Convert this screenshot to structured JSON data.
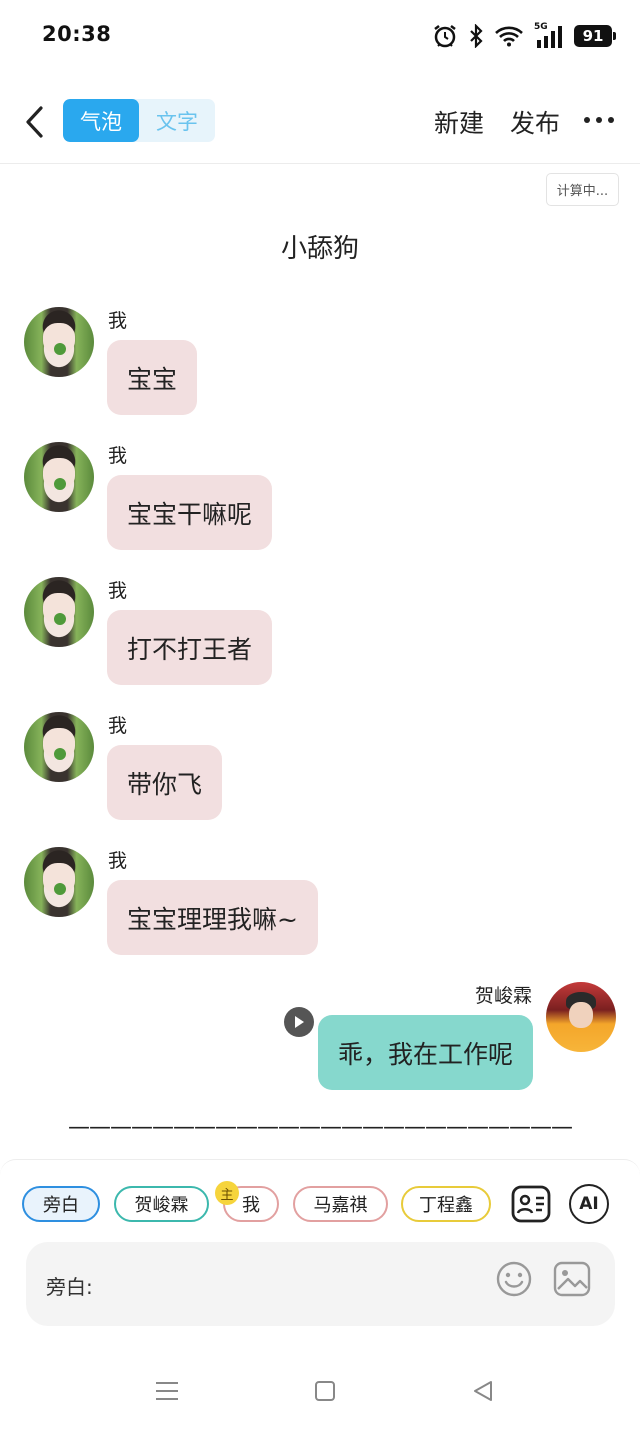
{
  "status_bar": {
    "time": "20:38",
    "network": "5G",
    "battery": "91"
  },
  "header": {
    "tabs": [
      {
        "label": "气泡",
        "active": true
      },
      {
        "label": "文字",
        "active": false
      }
    ],
    "new_label": "新建",
    "publish_label": "发布"
  },
  "calc_badge": "计算中...",
  "chat": {
    "title": "小舔狗",
    "messages": [
      {
        "sender": "我",
        "text": "宝宝",
        "side": "left"
      },
      {
        "sender": "我",
        "text": "宝宝干嘛呢",
        "side": "left"
      },
      {
        "sender": "我",
        "text": "打不打王者",
        "side": "left"
      },
      {
        "sender": "我",
        "text": "带你飞",
        "side": "left"
      },
      {
        "sender": "我",
        "text": "宝宝理理我嘛~",
        "side": "left"
      },
      {
        "sender": "贺峻霖",
        "text": "乖，我在工作呢",
        "side": "right"
      }
    ],
    "separator": "————————————————————————"
  },
  "composer": {
    "roles": [
      "旁白",
      "贺峻霖",
      "我",
      "马嘉祺",
      "丁程鑫"
    ],
    "main_badge": "主",
    "ai_label": "AI",
    "input_label": "旁白:"
  },
  "colors": {
    "accent": "#2aa8ee",
    "bubble_left": "#f2dfe0",
    "bubble_right": "#86d8cd"
  },
  "icons": {
    "back": "chevron-left-icon",
    "more": "more-horizontal-icon",
    "play": "play-icon",
    "contact_card": "contact-card-icon",
    "emoji": "smiley-icon",
    "image": "image-icon"
  }
}
